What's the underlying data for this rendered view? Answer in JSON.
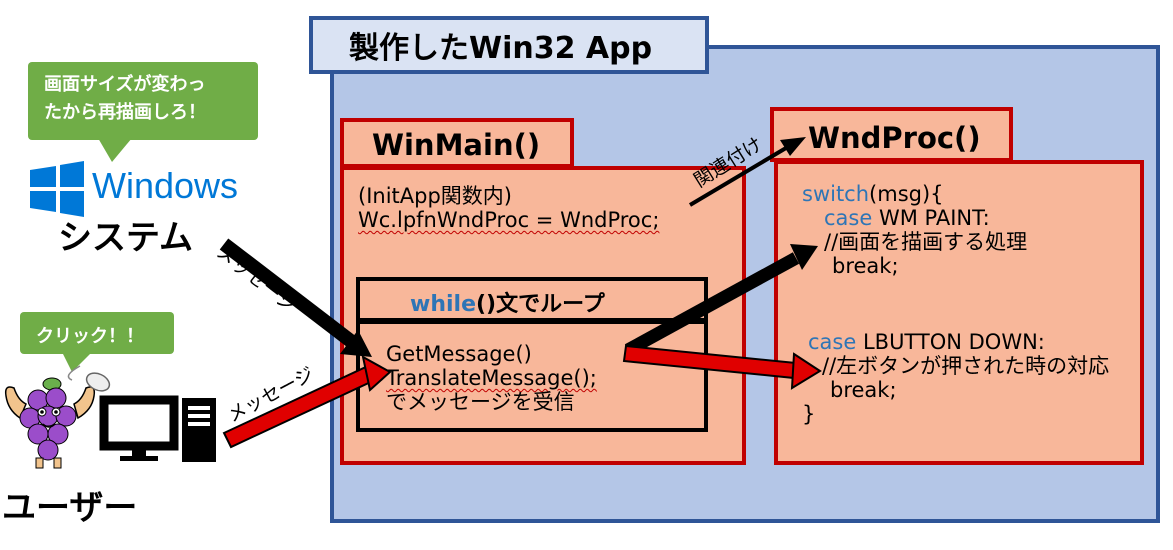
{
  "app": {
    "title": "製作したWin32 App"
  },
  "winmain": {
    "title": "WinMain()",
    "code_line1": "(InitApp関数内)",
    "code_line2": "Wc.lpfnWndProc = WndProc;",
    "while_keyword": "while",
    "while_rest": "()文でループ",
    "loop_line1": "GetMessage()",
    "loop_line2": "TranslateMessage();",
    "loop_line3": "でメッセージを受信"
  },
  "wndproc": {
    "title": "WndProc()",
    "switch_kw": "switch",
    "switch_rest": "(msg){",
    "case1_kw": "case",
    "case1_rest": " WM PAINT:",
    "comment1": "//画面を描画する処理",
    "break1": "break;",
    "case2_kw": "case",
    "case2_rest": " LBUTTON DOWN:",
    "comment2": "//左ボタンが押された時の対応",
    "break2": "break;",
    "close": "}"
  },
  "system": {
    "bubble_line1": "画面サイズが変わっ",
    "bubble_line2": "たから再描画しろ！",
    "windows_label": "Windows",
    "label": "システム"
  },
  "user": {
    "bubble": "クリック！！",
    "label": "ユーザー"
  },
  "arrows": {
    "system_message": "メッセージ",
    "user_message": "メッセージ",
    "association": "関連付け"
  },
  "colors": {
    "blue_frame": "#2f5597",
    "app_fill": "#b4c6e7",
    "salmon": "#f8b79a",
    "red_border": "#c00000",
    "green": "#70ad47",
    "keyword": "#2e75b6",
    "windows_blue": "#0078d7"
  },
  "icons": [
    "windows-logo-icon",
    "grape-mascot-icon",
    "mouse-icon",
    "monitor-icon",
    "pc-tower-icon"
  ]
}
